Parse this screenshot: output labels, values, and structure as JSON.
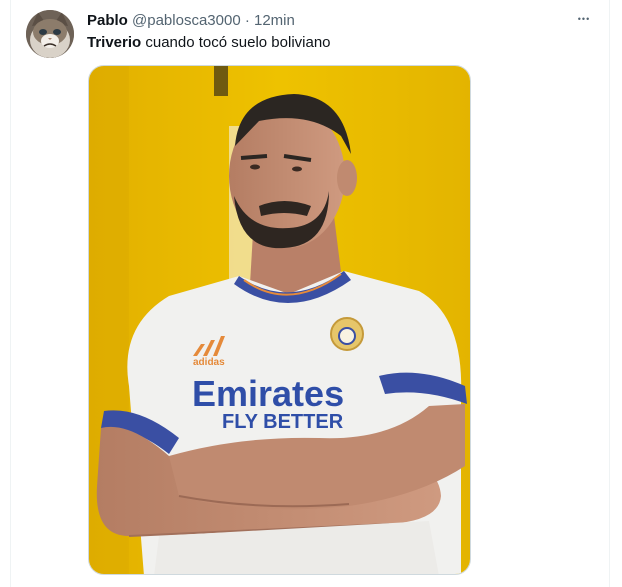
{
  "tweet": {
    "author": {
      "display_name": "Pablo",
      "handle": "@pablosca3000",
      "separator": "·",
      "timestamp": "12min",
      "avatar_icon": "grumpy-cat-avatar"
    },
    "text": {
      "bold": "Triverio",
      "rest": " cuando tocó suelo boliviano"
    },
    "more_icon": "more-dots-icon",
    "more_glyph": "•••",
    "media": {
      "description_icon": "photo-footballer-arms-crossed",
      "shirt_sponsor_line1": "Emirates",
      "shirt_sponsor_line2": "FLY BETTER",
      "shirt_brand": "adidas",
      "colors": {
        "background": "#e9b800",
        "shirt": "#f1f1ef",
        "trim": "#3a4fa3"
      }
    }
  }
}
